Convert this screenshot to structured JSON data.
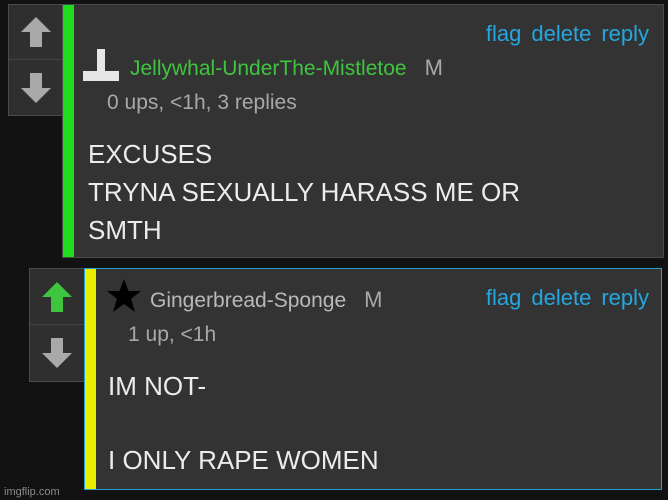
{
  "comments": [
    {
      "author": "Jellywhal-UnderThe-Mistletoe",
      "author_color": "#3fc43f",
      "badge": "M",
      "meta": "0 ups, <1h, 3 replies",
      "accent_color": "#1fdc1f",
      "actions": {
        "flag": "flag",
        "delete": "delete",
        "reply": "reply"
      },
      "upvoted": false,
      "avatar_icon": "inverted-t-icon",
      "body_lines": [
        "EXCUSES",
        "TRYNA SEXUALLY HARASS ME OR",
        "SMTH"
      ]
    },
    {
      "author": "Gingerbread-Sponge",
      "author_color": "#b9b9b9",
      "badge": "M",
      "meta": "1 up, <1h",
      "accent_color": "#e8ef00",
      "actions": {
        "flag": "flag",
        "delete": "delete",
        "reply": "reply"
      },
      "upvoted": true,
      "avatar_icon": "star-icon",
      "body_lines": [
        "IM NOT-",
        "",
        "I ONLY RAPE WOMEN"
      ]
    }
  ],
  "colors": {
    "action_link": "#24a6e0",
    "upvote_active": "#3fc43f",
    "arrow_inactive": "#a9a9a9"
  },
  "watermark": "imgflip.com"
}
